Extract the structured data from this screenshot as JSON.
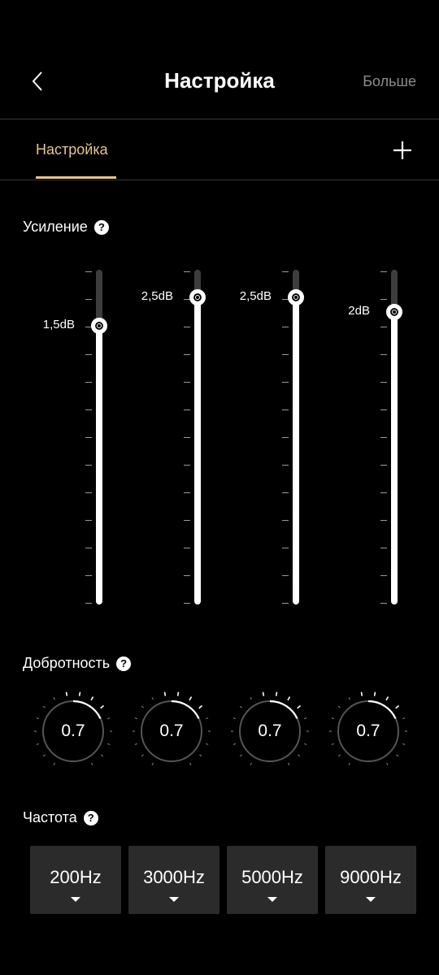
{
  "header": {
    "title": "Настройка",
    "more_label": "Больше"
  },
  "tabs": [
    {
      "label": "Настройка",
      "active": true
    }
  ],
  "gain": {
    "label": "Усиление",
    "bands": [
      {
        "value": 1.5,
        "label": "1,5dB"
      },
      {
        "value": 2.5,
        "label": "2,5dB"
      },
      {
        "value": 2.5,
        "label": "2,5dB"
      },
      {
        "value": 2.0,
        "label": "2dB"
      }
    ]
  },
  "q_factor": {
    "label": "Добротность",
    "knobs": [
      {
        "value": "0.7"
      },
      {
        "value": "0.7"
      },
      {
        "value": "0.7"
      },
      {
        "value": "0.7"
      }
    ]
  },
  "frequency": {
    "label": "Частота",
    "bands": [
      {
        "value": "200Hz"
      },
      {
        "value": "3000Hz"
      },
      {
        "value": "5000Hz"
      },
      {
        "value": "9000Hz"
      }
    ]
  },
  "colors": {
    "background": "#000000",
    "accent": "#e8c48c",
    "secondary_text": "#8c8c8c",
    "control_bg": "#2b2b2b"
  },
  "icons": {
    "back": "chevron-left-icon",
    "add": "plus-icon",
    "help": "question-circle-icon",
    "dropdown": "caret-down-icon"
  }
}
